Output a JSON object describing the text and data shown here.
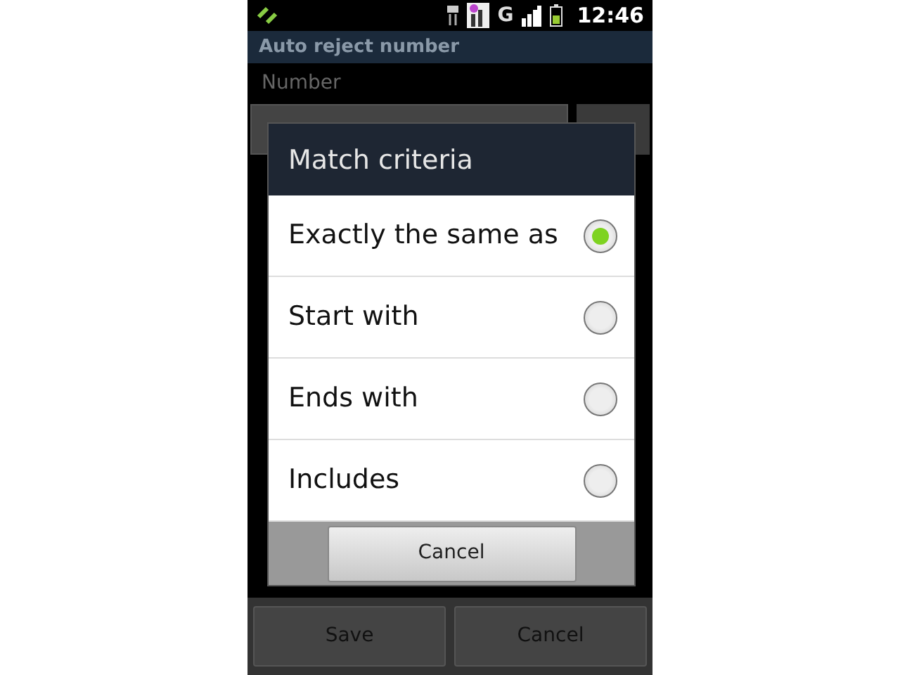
{
  "status_bar": {
    "network": "G",
    "time": "12:46"
  },
  "title_bar": {
    "title": "Auto reject number"
  },
  "form": {
    "label": "Number"
  },
  "dialog": {
    "title": "Match criteria",
    "options": [
      {
        "label": "Exactly the same as",
        "selected": true
      },
      {
        "label": "Start with",
        "selected": false
      },
      {
        "label": "Ends with",
        "selected": false
      },
      {
        "label": "Includes",
        "selected": false
      }
    ],
    "button": "Cancel"
  },
  "buttons": [
    "Save",
    "Cancel"
  ]
}
